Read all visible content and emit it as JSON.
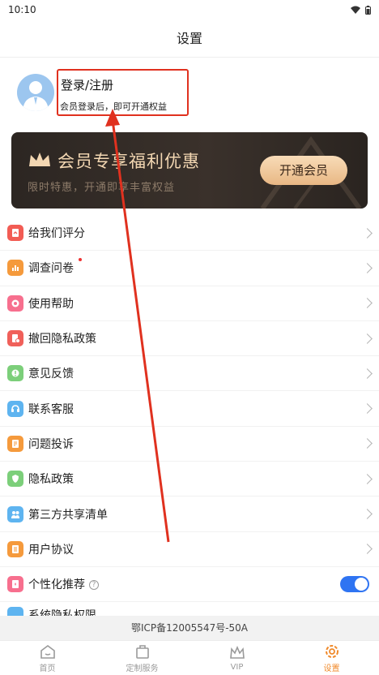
{
  "status_bar": {
    "time": "10:10"
  },
  "header": {
    "title": "设置"
  },
  "profile": {
    "title": "登录/注册",
    "subtitle": "会员登录后，即可开通权益"
  },
  "vip_banner": {
    "title": "会员专享福利优惠",
    "subtitle": "限时特惠，开通即享丰富权益",
    "button_label": "开通会员"
  },
  "menu": {
    "items": [
      {
        "label": "给我们评分",
        "icon": "rate-icon",
        "color": "#f25c54"
      },
      {
        "label": "调查问卷",
        "icon": "survey-icon",
        "color": "#f59a3c"
      },
      {
        "label": "使用帮助",
        "icon": "help-icon",
        "color": "#f76f8e"
      },
      {
        "label": "撤回隐私政策",
        "icon": "revoke-icon",
        "color": "#f0605a"
      },
      {
        "label": "意见反馈",
        "icon": "feedback-icon",
        "color": "#7ccf7a"
      },
      {
        "label": "联系客服",
        "icon": "service-icon",
        "color": "#5eb4f0"
      },
      {
        "label": "问题投诉",
        "icon": "complaint-icon",
        "color": "#f59a3c"
      },
      {
        "label": "隐私政策",
        "icon": "privacy-icon",
        "color": "#7ccf7a"
      },
      {
        "label": "第三方共享清单",
        "icon": "share-list-icon",
        "color": "#5eb4f0"
      },
      {
        "label": "用户协议",
        "icon": "agreement-icon",
        "color": "#f59a3c"
      },
      {
        "label": "个性化推荐",
        "icon": "recommend-icon",
        "color": "#f76f8e",
        "toggle_on": true
      },
      {
        "label": "系统隐私权限",
        "icon": "permission-icon",
        "color": "#5eb4f0"
      }
    ]
  },
  "footer": {
    "icp": "鄂ICP备12005547号-50A"
  },
  "tabs": [
    {
      "label": "首页",
      "icon": "home-icon",
      "active": false
    },
    {
      "label": "定制服务",
      "icon": "bag-icon",
      "active": false
    },
    {
      "label": "VIP",
      "icon": "crown-icon",
      "active": false
    },
    {
      "label": "设置",
      "icon": "settings-icon",
      "active": true
    }
  ],
  "colors": {
    "accent": "#f08a2b",
    "toggle": "#2f74f2",
    "highlight": "#e0311f"
  }
}
